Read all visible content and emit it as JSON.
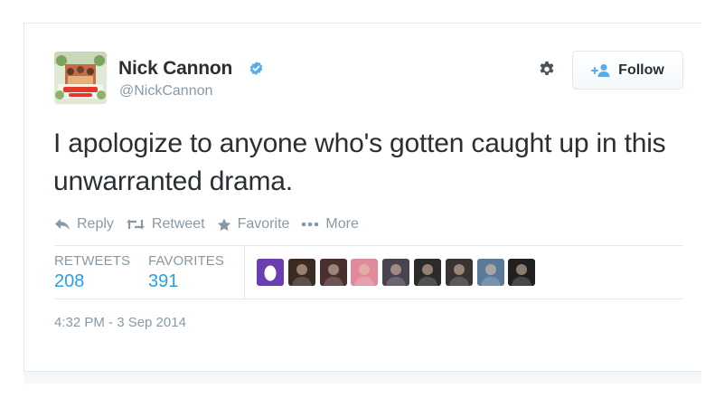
{
  "author": {
    "name": "Nick Cannon",
    "handle": "@NickCannon",
    "verified": true,
    "avatar_icon": "school-dance-poster-avatar"
  },
  "settings": {
    "icon": "gear-icon"
  },
  "follow": {
    "label": "Follow",
    "icon": "add-user-icon"
  },
  "tweet": {
    "text": "I apologize to anyone who's gotten caught up in this unwarranted drama."
  },
  "actions": [
    {
      "label": "Reply",
      "icon": "reply-icon"
    },
    {
      "label": "Retweet",
      "icon": "retweet-icon"
    },
    {
      "label": "Favorite",
      "icon": "star-icon"
    },
    {
      "label": "More",
      "icon": "more-dots-icon"
    }
  ],
  "stats": {
    "retweets_label": "RETWEETS",
    "retweets_count": "208",
    "favorites_label": "FAVORITES",
    "favorites_count": "391"
  },
  "favoriters": [
    {
      "color": "#6b3fb0",
      "kind": "egg"
    },
    {
      "color": "#3a2a22"
    },
    {
      "color": "#4a2f2f"
    },
    {
      "color": "#e08a9c"
    },
    {
      "color": "#4b4250"
    },
    {
      "color": "#2d2a2a"
    },
    {
      "color": "#3a3334"
    },
    {
      "color": "#5b7a9a"
    },
    {
      "color": "#202020"
    }
  ],
  "timestamp": "4:32 PM - 3 Sep 2014",
  "colors": {
    "link_blue": "#2aa0e3",
    "verified_blue": "#55acee",
    "muted_gray": "#8899a6",
    "text_dark": "#292f33"
  }
}
